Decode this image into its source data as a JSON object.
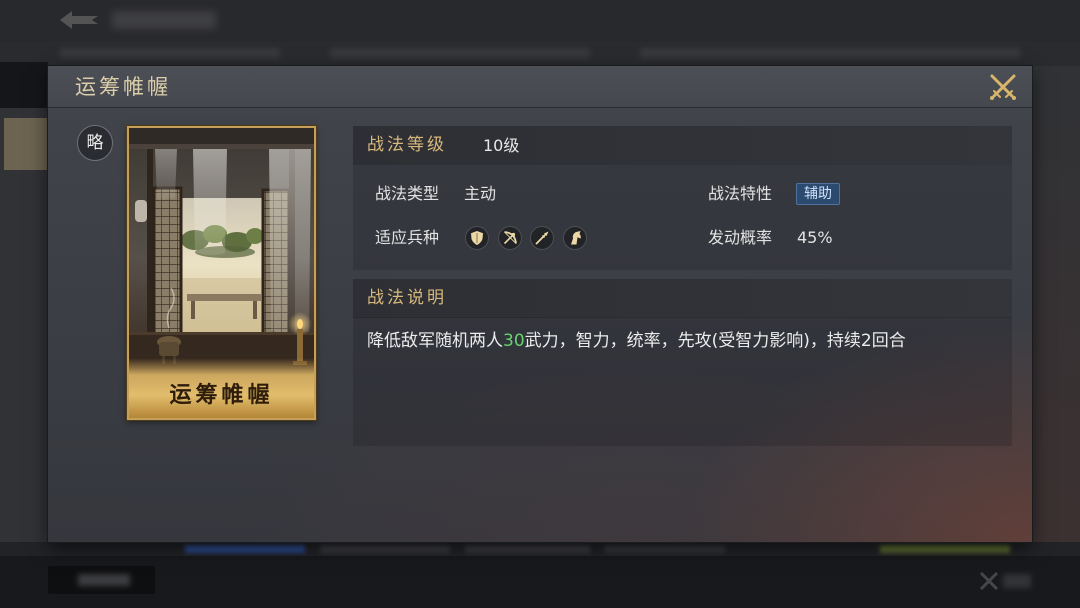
{
  "title": "运筹帷幄",
  "category_badge": "略",
  "card": {
    "name": "运筹帷幄"
  },
  "level": {
    "label": "战法等级",
    "value": "10级"
  },
  "info": {
    "type_label": "战法类型",
    "type_value": "主动",
    "trait_label": "战法特性",
    "trait_value": "辅助",
    "troops_label": "适应兵种",
    "troop_icons": [
      "shield-icon",
      "bow-icon",
      "spear-icon",
      "horse-icon"
    ],
    "rate_label": "发动概率",
    "rate_value": "45%"
  },
  "description": {
    "label": "战法说明",
    "text_before": "降低敌军随机两人",
    "highlight": "30",
    "text_after": "武力，智力，统率，先攻(受智力影响)，持续2回合"
  },
  "icons": {
    "close": "close-icon"
  },
  "colors": {
    "accent_gold": "#d8b97c",
    "highlight_green": "#66d36c",
    "trait_badge": "#2c4a6e",
    "title_text": "#dccdaa"
  }
}
